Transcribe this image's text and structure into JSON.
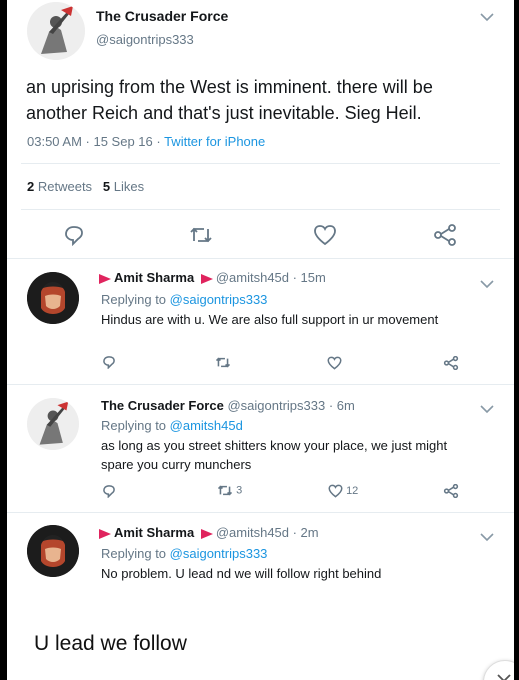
{
  "main_tweet": {
    "author_name": "The Crusader Force",
    "handle": "@saigontrips333",
    "text_line1": "an uprising from the West is imminent. there will be",
    "text_line2": "another Reich and that's just inevitable. Sieg Heil.",
    "time": "03:50 AM · 15 Sep 16 · ",
    "source": "Twitter for iPhone",
    "retweets_count": "2",
    "retweets_label": "Retweets",
    "likes_count": "5",
    "likes_label": "Likes"
  },
  "replies": [
    {
      "author_name": "Amit Sharma",
      "handle_time": "@amitsh45d · 15m",
      "replying_prefix": "Replying to ",
      "replying_to": "@saigontrips333",
      "text": "Hindus are with u. We are also full support in ur movement",
      "retweet_count": "",
      "like_count": ""
    },
    {
      "author_name": "The Crusader Force",
      "handle_time": "@saigontrips333 · 6m",
      "replying_prefix": "Replying to ",
      "replying_to": "@amitsh45d",
      "text_line1": "as long as you street shitters know your place, we just might",
      "text_line2": "spare you curry munchers",
      "retweet_count": "3",
      "like_count": "12"
    },
    {
      "author_name": "Amit Sharma",
      "handle_time": "@amitsh45d · 2m",
      "replying_prefix": "Replying to ",
      "replying_to": "@saigontrips333",
      "text": "No problem. U lead nd we will follow right behind"
    }
  ],
  "caption": "U lead we follow",
  "colors": {
    "link": "#1b95e0",
    "muted": "#657786",
    "text": "#14171a",
    "flag": "#e0245e"
  }
}
